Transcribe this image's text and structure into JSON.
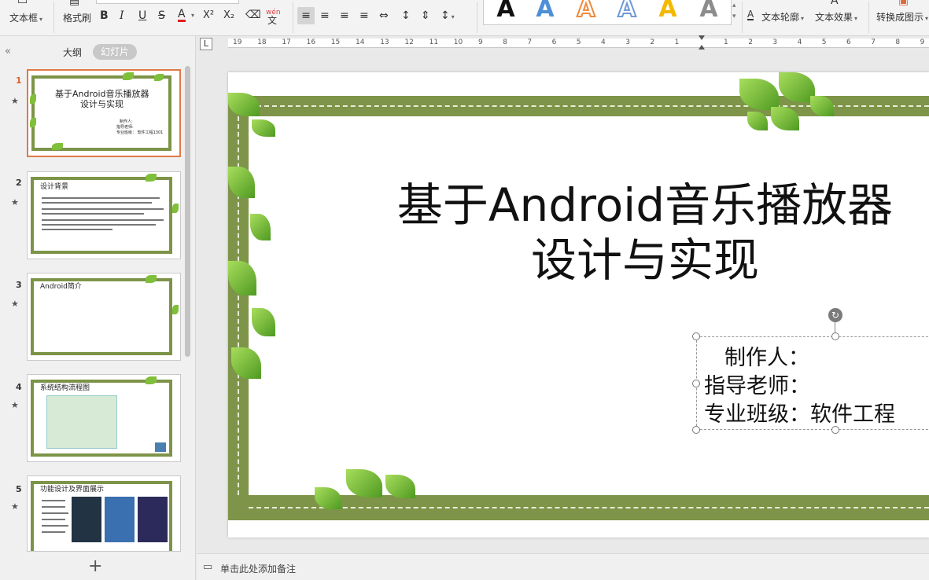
{
  "ribbon": {
    "textbox_label": "文本框",
    "format_painter_label": "格式刷",
    "bold": "B",
    "italic": "I",
    "underline": "U",
    "strikethrough": "S",
    "font_color": "A",
    "superscript": "X²",
    "subscript": "X₂",
    "eraser_icon": "eraser-icon",
    "phonetic": "wén",
    "phonetic_char": "文",
    "wordart_letter": "A",
    "text_outline_label": "文本轮廓",
    "text_effect_label": "文本效果",
    "convert_label": "转换成图示",
    "wordart_colors": [
      "#111111",
      "#4f8fd6",
      "#f08a3c",
      "#6f9ad6",
      "#f5b800",
      "#8c8c8c"
    ]
  },
  "left_panel": {
    "tab_outline": "大纲",
    "tab_slides": "幻灯片",
    "collapse_icon": "«",
    "add_slide": "+",
    "slides": [
      {
        "num": "1",
        "star": "★",
        "title_l1": "基于Android音乐播放器",
        "title_l2": "设计与实现",
        "meta_l1": "制作人:",
        "meta_l2": "指导老师:",
        "meta_l3": "专业班级：  软件工程1301"
      },
      {
        "num": "2",
        "star": "★",
        "title": "设计背景"
      },
      {
        "num": "3",
        "star": "★",
        "title": "Android简介"
      },
      {
        "num": "4",
        "star": "★",
        "title": "系统结构流程图"
      },
      {
        "num": "5",
        "star": "★",
        "title": "功能设计及界面展示"
      }
    ]
  },
  "ruler": {
    "corner": "L",
    "labels": [
      "19",
      "18",
      "17",
      "16",
      "15",
      "14",
      "13",
      "12",
      "11",
      "10",
      "9",
      "8",
      "7",
      "6",
      "5",
      "4",
      "3",
      "2",
      "1",
      "",
      "1",
      "2",
      "3",
      "4",
      "5",
      "6",
      "7",
      "8",
      "9"
    ]
  },
  "slide": {
    "title_l1": "基于Android音乐播放器",
    "title_l2": "设计与实现",
    "sub_l1": "制作人：",
    "sub_l2": "指导老师：",
    "sub_l3": "专业班级：软件工程",
    "rotate_icon": "↻",
    "frame_color": "#7e9448"
  },
  "notes": {
    "icon": "notes-icon",
    "placeholder": "单击此处添加备注"
  }
}
